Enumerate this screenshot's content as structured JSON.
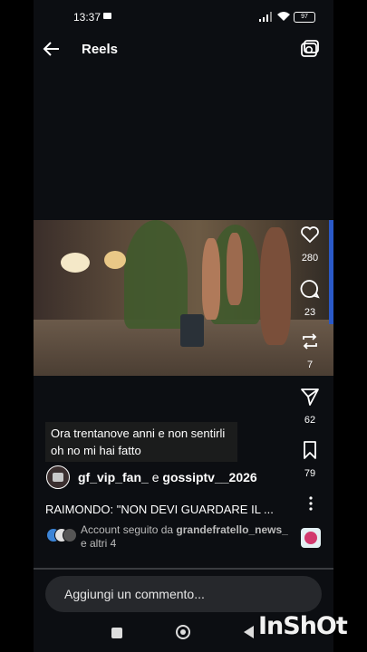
{
  "status_bar": {
    "time": "13:37",
    "battery": "97"
  },
  "top_bar": {
    "title": "Reels"
  },
  "actions": {
    "likes": "280",
    "comments": "23",
    "reposts": "7",
    "shares": "62",
    "saves": "79"
  },
  "caption": "Ora trentanove anni e non sentirli oh no mi hai fatto",
  "authors": {
    "primary": "gf_vip_fan_",
    "conjunction": "e",
    "secondary": "gossiptv__2026"
  },
  "headline": "RAIMONDO: \"NON DEVI GUARDARE IL ...",
  "followed_by": {
    "prefix": "Account seguito da",
    "account": "grandefratello_news_",
    "suffix": "e altri 4"
  },
  "comment_placeholder": "Aggiungi un commento...",
  "watermark": "InShOt",
  "colors": {
    "background": "#0c0e12",
    "accent": "#2a59c8"
  },
  "icons": [
    "back-arrow-icon",
    "camera-icon",
    "heart-icon",
    "comment-icon",
    "repost-icon",
    "share-icon",
    "bookmark-icon",
    "more-icon"
  ]
}
